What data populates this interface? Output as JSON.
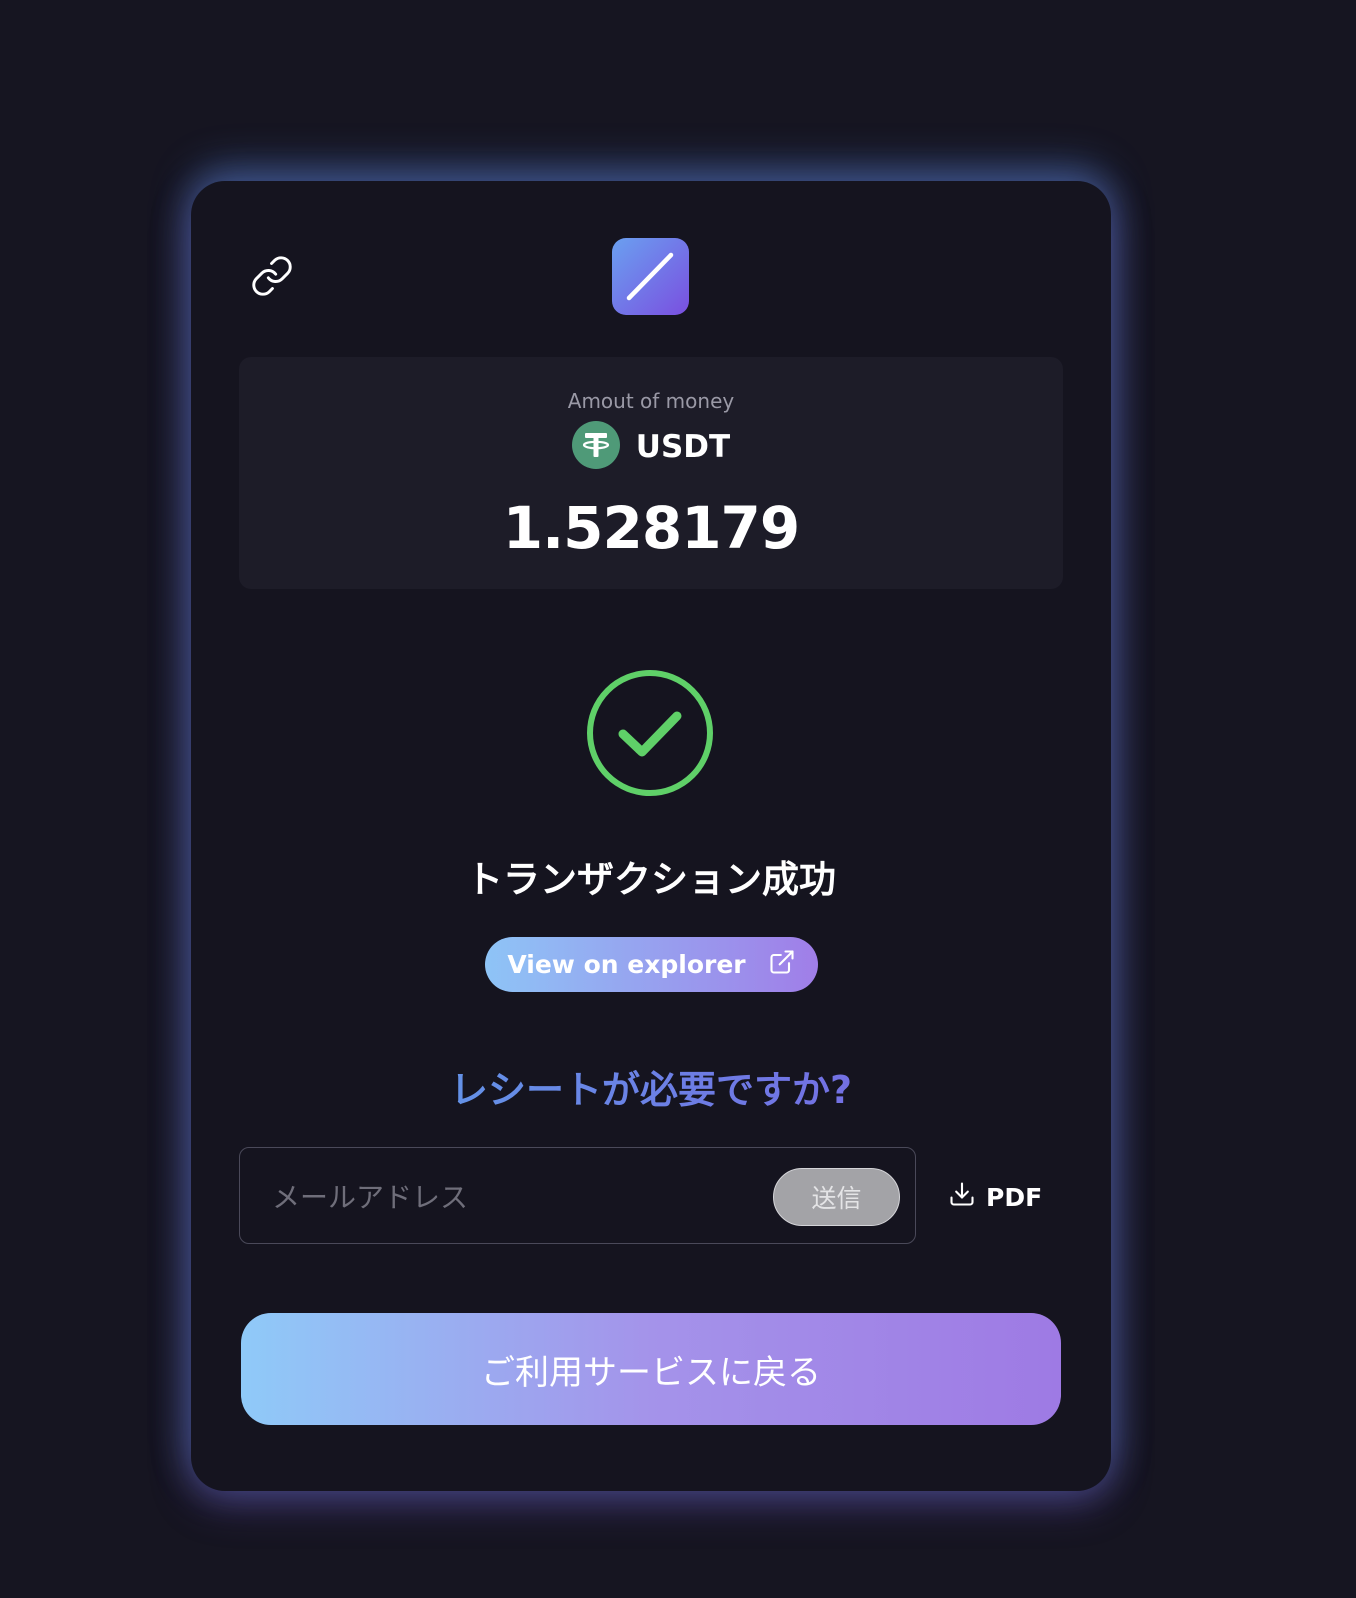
{
  "amount": {
    "label": "Amout of money",
    "token": "USDT",
    "value": "1.528179"
  },
  "status": {
    "title": "トランザクション成功",
    "explorer_label": "View on explorer"
  },
  "receipt": {
    "question": "レシートが必要ですか?",
    "email_placeholder": "メールアドレス",
    "send_label": "送信",
    "pdf_label": "PDF"
  },
  "actions": {
    "back_label": "ご利用サービスに戻る"
  },
  "colors": {
    "background": "#161521",
    "card": "#15141f",
    "success_green": "#5fd068",
    "usdt_green": "#4f9a78",
    "gradient_start": "#8ec4f6",
    "gradient_end": "#a07ee8"
  },
  "icons": [
    "link-icon",
    "logo-icon",
    "usdt-icon",
    "check-circle-icon",
    "external-link-icon",
    "download-icon"
  ]
}
